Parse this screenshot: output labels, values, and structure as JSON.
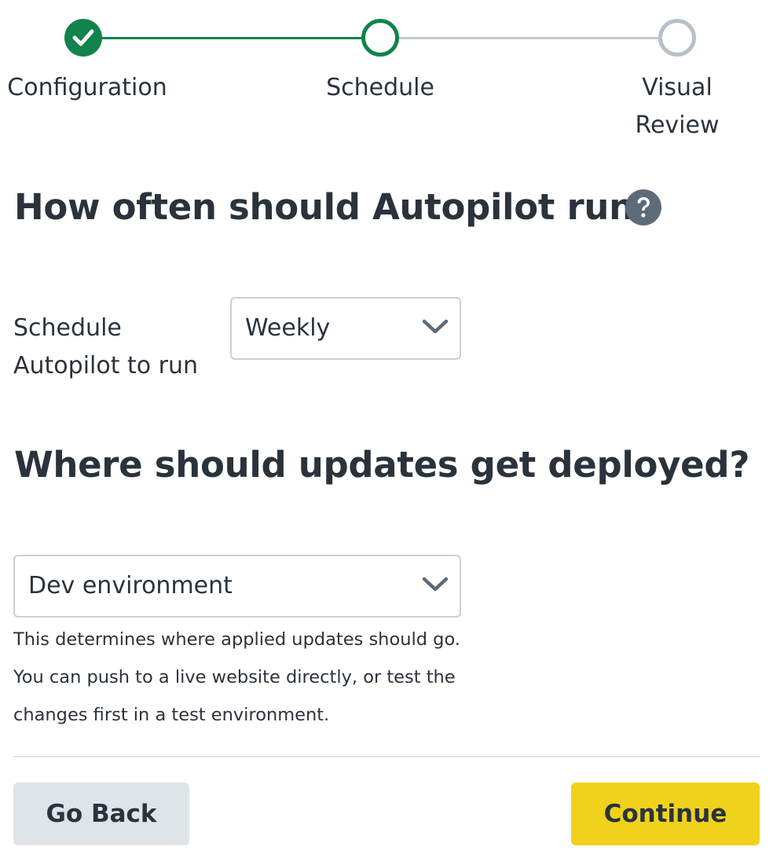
{
  "stepper": {
    "steps": [
      {
        "label": "Configuration",
        "state": "complete"
      },
      {
        "label": "Schedule",
        "state": "current"
      },
      {
        "label": "Visual Review",
        "state": "upcoming",
        "label_lines": [
          "Visual",
          "Review"
        ]
      }
    ]
  },
  "schedule_section": {
    "heading": "How often should Autopilot run?",
    "help_icon": "question-circle-icon",
    "field_label": "Schedule Autopilot to run",
    "selected": "Weekly",
    "dropdown_icon": "chevron-down-icon"
  },
  "deploy_section": {
    "heading": "Where should updates get deployed?",
    "selected": "Dev environment",
    "dropdown_icon": "chevron-down-icon",
    "help_lines": [
      "This determines where applied updates should go.",
      "You can push to a live website directly, or test the",
      "changes first in a test environment."
    ]
  },
  "actions": {
    "back_label": "Go Back",
    "continue_label": "Continue"
  },
  "colors": {
    "complete_green": "#13824b",
    "upcoming_gray": "#b7c0c9",
    "primary_yellow": "#f0d21d",
    "secondary_gray": "#dfe4e8",
    "text_dark": "#2a333c",
    "icon_slate": "#5d6b79"
  }
}
